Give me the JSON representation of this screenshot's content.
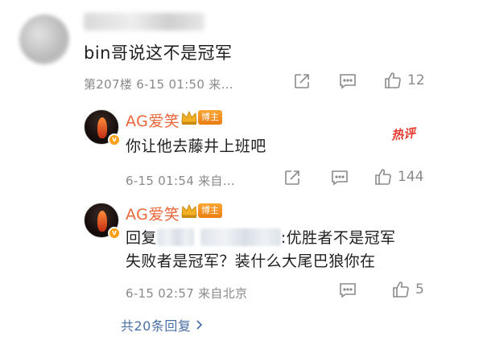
{
  "top_comment": {
    "text": "bin哥说这不是冠军",
    "meta": "第207楼 6-15 01:50 来…",
    "likes": "12"
  },
  "reply1": {
    "name": "AG爱笑",
    "blogger_label": "博主",
    "hot_label": "热评",
    "text": "你让他去藤井上班吧",
    "meta": "6-15 01:54 来自…",
    "likes": "144"
  },
  "reply2": {
    "name": "AG爱笑",
    "blogger_label": "博主",
    "reply_prefix": "回复",
    "text_line1": ":优胜者不是冠军",
    "text_line2": "失败者是冠军？装什么大尾巴狼你在",
    "meta": "6-15 02:57 来自北京",
    "likes": "5"
  },
  "more_replies": "共20条回复",
  "icons": [
    "share-icon",
    "comment-icon",
    "like-icon",
    "chevron-right-icon",
    "crown-icon",
    "verified-icon"
  ],
  "colors": {
    "name": "#e8673a",
    "link": "#4a6fa5",
    "meta": "#8a8a8a",
    "hot": "#e63a2e",
    "badge": "#ff9f1a"
  }
}
